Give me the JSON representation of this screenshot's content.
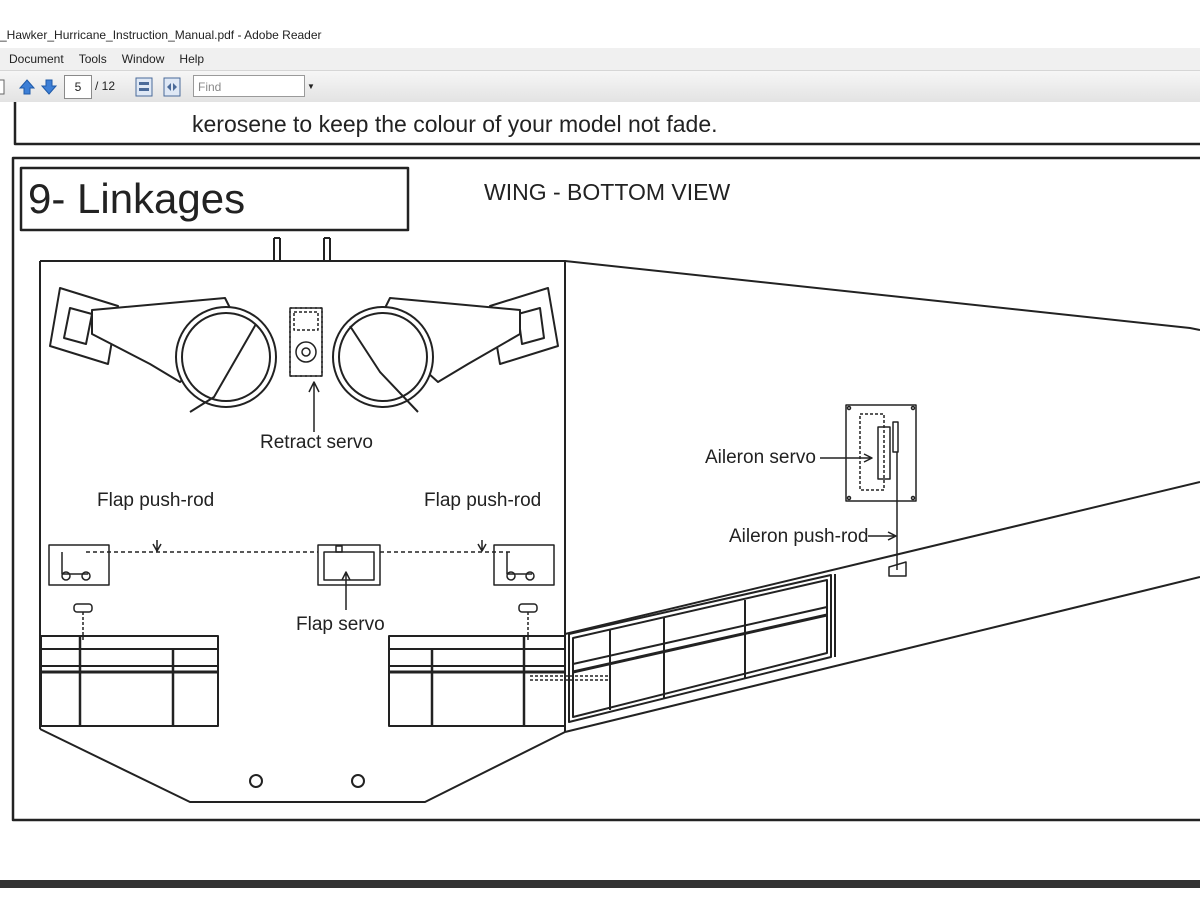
{
  "window": {
    "title": "_Hawker_Hurricane_Instruction_Manual.pdf - Adobe Reader"
  },
  "menu": [
    "Document",
    "Tools",
    "Window",
    "Help"
  ],
  "toolbar": {
    "page_current": "5",
    "page_total": "/ 12",
    "find_placeholder": "Find"
  },
  "document": {
    "top_text": "kerosene to keep the colour of your model not fade.",
    "section_title": "9- Linkages",
    "view_title": "WING - BOTTOM VIEW",
    "labels": {
      "retract_servo": "Retract servo",
      "flap_pushrod_left": "Flap push-rod",
      "flap_pushrod_right": "Flap push-rod",
      "flap_servo": "Flap servo",
      "aileron_servo": "Aileron servo",
      "aileron_pushrod": "Aileron push-rod"
    }
  }
}
